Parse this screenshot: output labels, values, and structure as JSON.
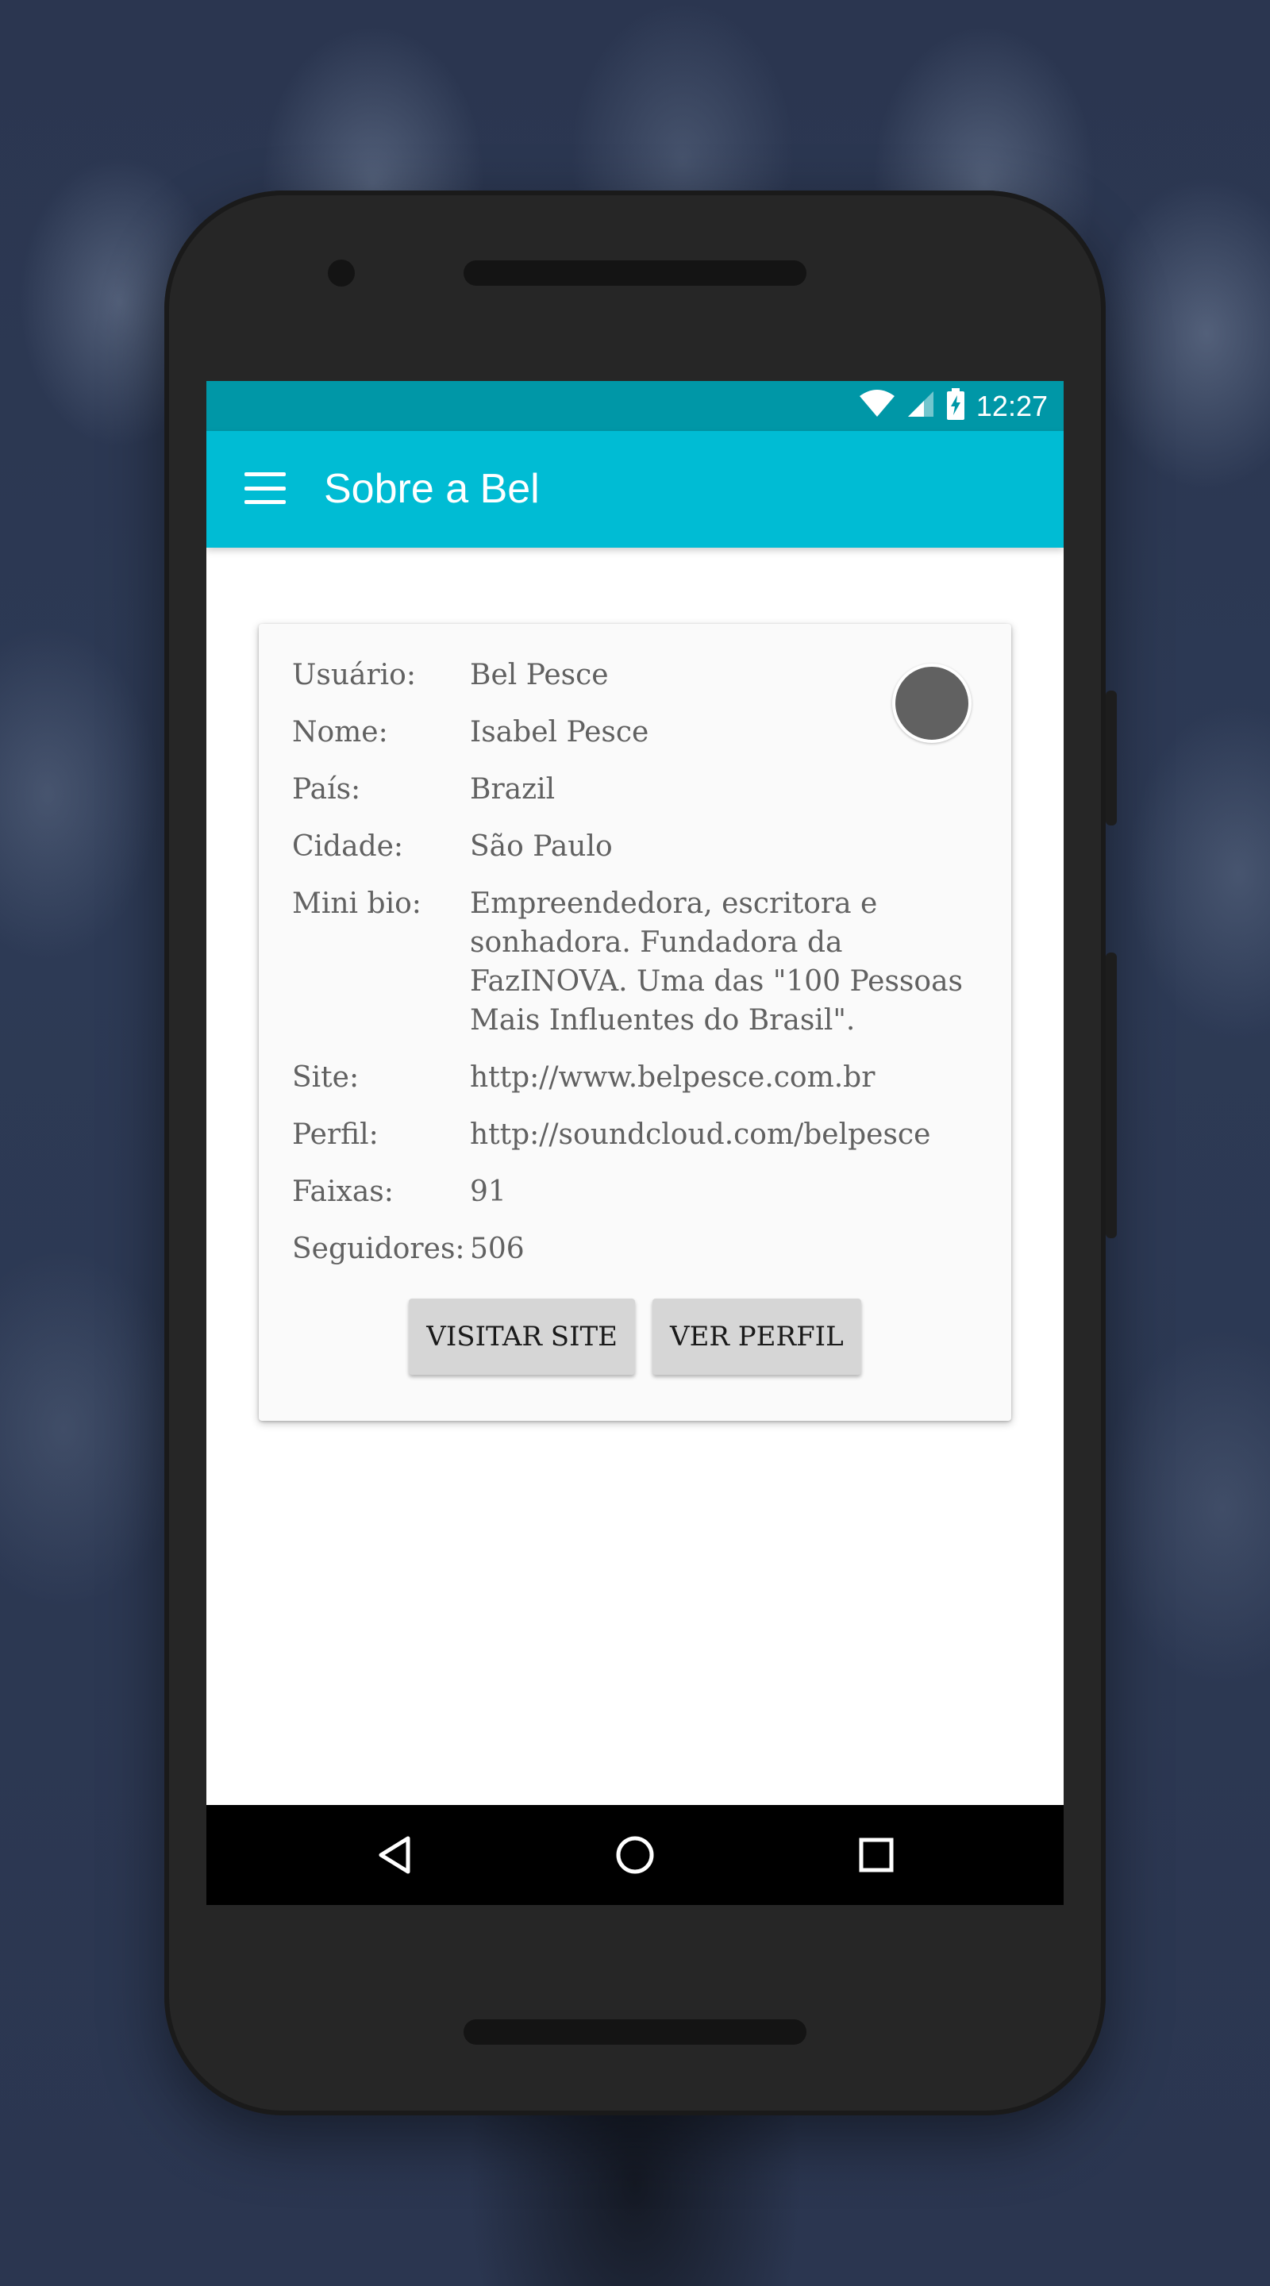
{
  "status_bar": {
    "time": "12:27",
    "icons": [
      "wifi-icon",
      "cellular-signal-icon",
      "battery-charging-icon"
    ],
    "color": "#0097a7"
  },
  "app_bar": {
    "title": "Sobre a Bel",
    "menu_icon": "menu-icon",
    "color": "#00bcd4"
  },
  "profile": {
    "rows": [
      {
        "label": "Usuário:",
        "value": "Bel Pesce"
      },
      {
        "label": "Nome:",
        "value": "Isabel Pesce"
      },
      {
        "label": "País:",
        "value": "Brazil"
      },
      {
        "label": "Cidade:",
        "value": "São Paulo"
      },
      {
        "label": "Mini bio:",
        "value": "Empreendedora, escritora e sonhadora. Fundadora da FazINOVA. Uma das \"100 Pessoas Mais Influentes do Brasil\"."
      },
      {
        "label": "Site:",
        "value": "http://www.belpesce.com.br"
      },
      {
        "label": "Perfil:",
        "value": "http://soundcloud.com/belpesce"
      },
      {
        "label": "Faixas:",
        "value": "91"
      },
      {
        "label": "Seguidores:",
        "value": "506"
      }
    ],
    "avatar_color": "#616161"
  },
  "actions": {
    "visit_site_label": "VISITAR SITE",
    "view_profile_label": "VER PERFIL"
  },
  "nav_bar": {
    "icons": [
      "back-icon",
      "home-icon",
      "recents-icon"
    ]
  }
}
